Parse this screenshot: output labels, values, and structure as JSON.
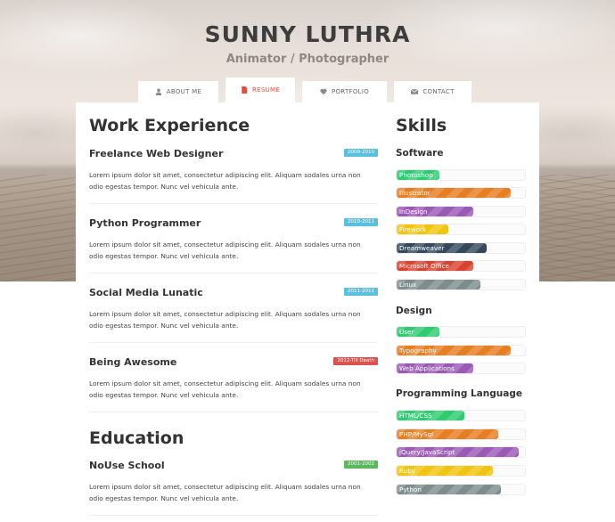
{
  "header": {
    "name": "SUNNY LUTHRA",
    "subtitle": "Animator / Photographer"
  },
  "tabs": [
    {
      "label": "ABOUT ME",
      "icon": "user-icon",
      "active": false
    },
    {
      "label": "RESUME",
      "icon": "document-icon",
      "active": true
    },
    {
      "label": "PORTFOLIO",
      "icon": "heart-icon",
      "active": false
    },
    {
      "label": "CONTACT",
      "icon": "envelope-icon",
      "active": false
    }
  ],
  "work": {
    "title": "Work Experience",
    "items": [
      {
        "title": "Freelance Web Designer",
        "period": "2009-2010",
        "badge_color": "#5bc0de",
        "desc": "Lorem ipsum dolor sit amet, consectetur adipiscing elit. Aliquam sodales urna non odio egestas tempor. Nunc vel vehicula ante."
      },
      {
        "title": "Python Programmer",
        "period": "2010-2011",
        "badge_color": "#5bc0de",
        "desc": "Lorem ipsum dolor sit amet, consectetur adipiscing elit. Aliquam sodales urna non odio egestas tempor. Nunc vel vehicula ante."
      },
      {
        "title": "Social Media Lunatic",
        "period": "2011-2012",
        "badge_color": "#5bc0de",
        "desc": "Lorem ipsum dolor sit amet, consectetur adipiscing elit. Aliquam sodales urna non odio egestas tempor. Nunc vel vehicula ante."
      },
      {
        "title": "Being Awesome",
        "period": "2012-Till Death",
        "badge_color": "#d9534f",
        "desc": "Lorem ipsum dolor sit amet, consectetur adipiscing elit. Aliquam sodales urna non odio egestas tempor. Nunc vel vehicula ante."
      }
    ]
  },
  "education": {
    "title": "Education",
    "items": [
      {
        "title": "NoUse School",
        "period": "2001-2002",
        "badge_color": "#5cb85c",
        "desc": "Lorem ipsum dolor sit amet, consectetur adipiscing elit. Aliquam sodales urna non odio egestas tempor. Nunc vel vehicula ante."
      }
    ]
  },
  "skills": {
    "title": "Skills",
    "groups": [
      {
        "title": "Software",
        "items": [
          {
            "label": "Photoshop",
            "level": 0.33,
            "color": "#2ecc71"
          },
          {
            "label": "Illustrator",
            "level": 0.89,
            "color": "#e67e22"
          },
          {
            "label": "InDesign",
            "level": 0.6,
            "color": "#9b59b6"
          },
          {
            "label": "Firework",
            "level": 0.4,
            "color": "#f1c40f"
          },
          {
            "label": "Dreamweaver",
            "level": 0.7,
            "color": "#34495e"
          },
          {
            "label": "Microsoft Office",
            "level": 0.6,
            "color": "#d9432f"
          },
          {
            "label": "Linux",
            "level": 0.65,
            "color": "#7f8c8d"
          }
        ]
      },
      {
        "title": "Design",
        "items": [
          {
            "label": "User",
            "level": 0.33,
            "color": "#2ecc71"
          },
          {
            "label": "Typography",
            "level": 0.89,
            "color": "#e67e22"
          },
          {
            "label": "Web Applications",
            "level": 0.6,
            "color": "#9b59b6"
          }
        ]
      },
      {
        "title": "Programming Language",
        "items": [
          {
            "label": "HTML/CSS",
            "level": 0.53,
            "color": "#2ecc71"
          },
          {
            "label": "PHP/MySql",
            "level": 0.79,
            "color": "#e67e22"
          },
          {
            "label": "jQuery/JavaScript",
            "level": 0.95,
            "color": "#9b59b6"
          },
          {
            "label": "Ruby",
            "level": 0.75,
            "color": "#f1c40f"
          },
          {
            "label": "Python",
            "level": 0.81,
            "color": "#7f8c8d"
          }
        ]
      }
    ]
  }
}
